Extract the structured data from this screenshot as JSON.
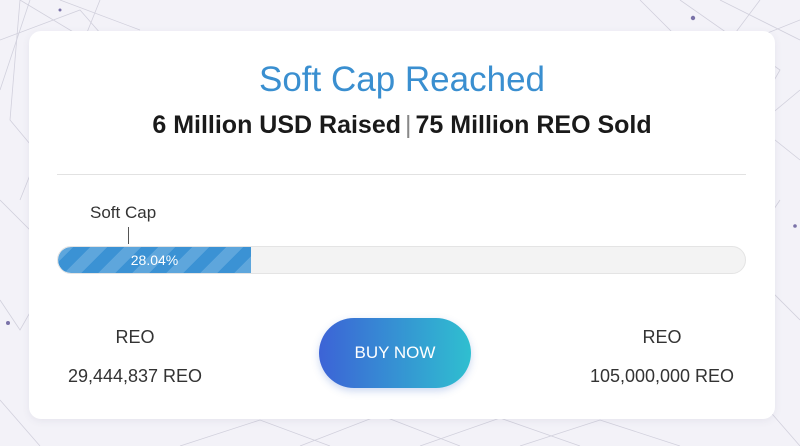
{
  "header": {
    "title": "Soft Cap Reached",
    "raised": "6 Million USD Raised",
    "separator": "|",
    "sold": "75 Million REO Sold"
  },
  "progress": {
    "marker_label": "Soft Cap",
    "percent_label": "28.04%",
    "fraction": 0.2804,
    "fill_color": "#3b92d4"
  },
  "stats": {
    "left": {
      "label": "REO",
      "value": "29,444,837 REO"
    },
    "right": {
      "label": "REO",
      "value": "105,000,000 REO"
    }
  },
  "actions": {
    "buy_label": "BUY NOW"
  },
  "colors": {
    "accent": "#3a8fd0",
    "button_gradient_start": "#3c63d6",
    "button_gradient_end": "#2fbfd0"
  }
}
